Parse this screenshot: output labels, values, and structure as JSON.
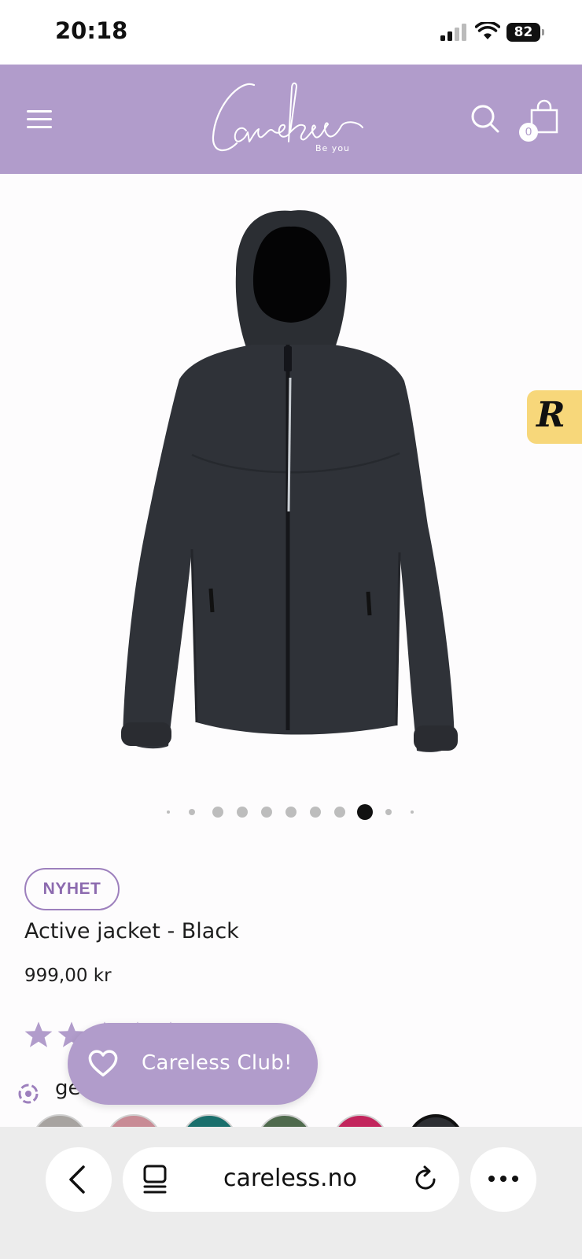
{
  "status_bar": {
    "time": "20:18",
    "battery": "82"
  },
  "header": {
    "logo_text": "Careless",
    "logo_tagline": "Be you",
    "cart_count": "0",
    "brand_color": "#b19ccb",
    "icons": [
      "menu-icon",
      "search-icon",
      "shopping-bag-icon"
    ]
  },
  "gallery": {
    "image_alt": "Active jacket - Black",
    "dot_count": 11,
    "active_dot": 8
  },
  "rewards": {
    "label": "R",
    "color": "#f7d77a"
  },
  "product": {
    "badge": "NYHET",
    "title": "Active jacket - Black",
    "price": "999,00 kr",
    "rating": 5,
    "reviews_text": "ge"
  },
  "club": {
    "label": "Careless Club!"
  },
  "browser": {
    "url": "careless.no"
  }
}
